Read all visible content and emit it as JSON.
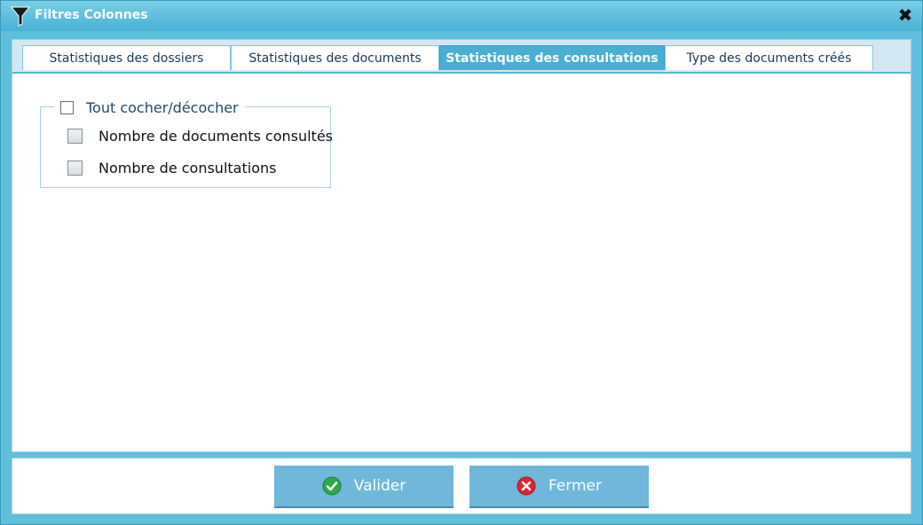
{
  "window": {
    "title": "Filtres Colonnes",
    "close_glyph": "✖",
    "title_icon": "filter-icon"
  },
  "tabs": [
    {
      "label": "Statistiques des dossiers",
      "active": false
    },
    {
      "label": "Statistiques des documents",
      "active": false
    },
    {
      "label": "Statistiques des consultations",
      "active": true
    },
    {
      "label": "Type des documents créés",
      "active": false
    }
  ],
  "columns_group": {
    "toggle_all_label": "Tout cocher/décocher",
    "toggle_all_checked": false,
    "items": [
      {
        "label": "Nombre de documents consultés",
        "checked": false
      },
      {
        "label": "Nombre de consultations",
        "checked": false
      }
    ]
  },
  "footer": {
    "validate_label": "Valider",
    "validate_icon": "check-circle-icon",
    "close_label": "Fermer",
    "close_icon": "x-circle-icon"
  },
  "colors": {
    "accent": "#4aaed3",
    "titlebar": "#5fbfdc",
    "button": "#6fb7db",
    "validate_icon": "#2fa84a",
    "close_icon": "#e0242c"
  }
}
